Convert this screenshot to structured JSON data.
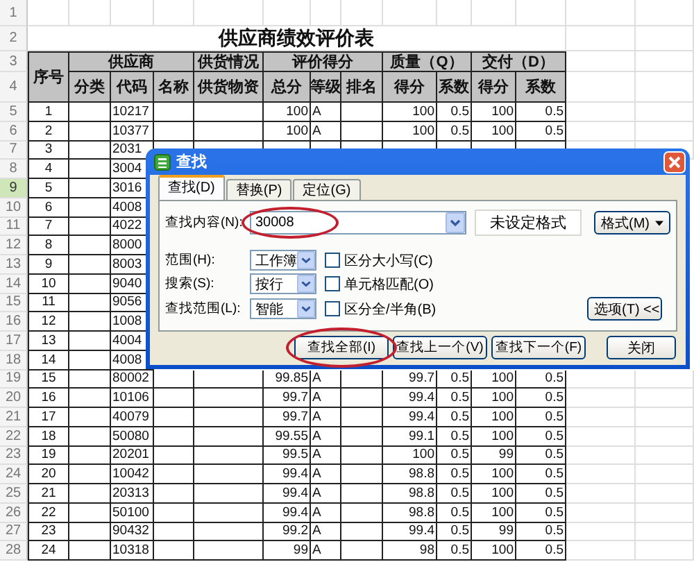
{
  "sheet": {
    "title": "供应商绩效评价表",
    "row_headers": [
      {
        "label": "1",
        "selected": false
      },
      {
        "label": "2",
        "selected": false
      },
      {
        "label": "3",
        "selected": false
      },
      {
        "label": "4",
        "selected": false
      },
      {
        "label": "5",
        "selected": false
      },
      {
        "label": "6",
        "selected": false
      },
      {
        "label": "7",
        "selected": false
      },
      {
        "label": "8",
        "selected": false
      },
      {
        "label": "9",
        "selected": true
      },
      {
        "label": "10",
        "selected": false
      },
      {
        "label": "11",
        "selected": false
      },
      {
        "label": "12",
        "selected": false
      },
      {
        "label": "13",
        "selected": false
      },
      {
        "label": "14",
        "selected": false
      },
      {
        "label": "15",
        "selected": false
      },
      {
        "label": "16",
        "selected": false
      },
      {
        "label": "17",
        "selected": false
      },
      {
        "label": "18",
        "selected": false
      },
      {
        "label": "19",
        "selected": false
      },
      {
        "label": "20",
        "selected": false
      },
      {
        "label": "21",
        "selected": false
      },
      {
        "label": "22",
        "selected": false
      },
      {
        "label": "23",
        "selected": false
      },
      {
        "label": "24",
        "selected": false
      },
      {
        "label": "25",
        "selected": false
      },
      {
        "label": "26",
        "selected": false
      },
      {
        "label": "27",
        "selected": false
      },
      {
        "label": "28",
        "selected": false
      }
    ],
    "group_headers": {
      "seq": "序号",
      "supplier": "供应商",
      "supply": "供货情况",
      "evaluation": "评价得分",
      "quality": "质量（Q）",
      "delivery": "交付（D）"
    },
    "sub_headers": [
      "分类",
      "代码",
      "名称",
      "供货物资",
      "总分",
      "等级",
      "排名",
      "得分",
      "系数",
      "得分",
      "系数"
    ],
    "rows": [
      {
        "seq": "1",
        "code": "10217",
        "total": "100",
        "grade": "A",
        "q_score": "100",
        "q_coef": "0.5",
        "d_score": "100",
        "d_coef": "0.5"
      },
      {
        "seq": "2",
        "code": "10377",
        "total": "100",
        "grade": "A",
        "q_score": "100",
        "q_coef": "0.5",
        "d_score": "100",
        "d_coef": "0.5"
      },
      {
        "seq": "3",
        "code": "2031"
      },
      {
        "seq": "4",
        "code": "3004"
      },
      {
        "seq": "5",
        "code": "3016"
      },
      {
        "seq": "6",
        "code": "4008"
      },
      {
        "seq": "7",
        "code": "4022"
      },
      {
        "seq": "8",
        "code": "8000"
      },
      {
        "seq": "9",
        "code": "8003"
      },
      {
        "seq": "10",
        "code": "9040"
      },
      {
        "seq": "11",
        "code": "9056"
      },
      {
        "seq": "12",
        "code": "1008"
      },
      {
        "seq": "13",
        "code": "4004"
      },
      {
        "seq": "14",
        "code": "4008"
      },
      {
        "seq": "15",
        "code": "80002",
        "total": "99.85",
        "grade": "A",
        "q_score": "99.7",
        "q_coef": "0.5",
        "d_score": "100",
        "d_coef": "0.5"
      },
      {
        "seq": "16",
        "code": "10106",
        "total": "99.7",
        "grade": "A",
        "q_score": "99.4",
        "q_coef": "0.5",
        "d_score": "100",
        "d_coef": "0.5"
      },
      {
        "seq": "17",
        "code": "40079",
        "total": "99.7",
        "grade": "A",
        "q_score": "99.4",
        "q_coef": "0.5",
        "d_score": "100",
        "d_coef": "0.5"
      },
      {
        "seq": "18",
        "code": "50080",
        "total": "99.55",
        "grade": "A",
        "q_score": "99.1",
        "q_coef": "0.5",
        "d_score": "100",
        "d_coef": "0.5"
      },
      {
        "seq": "19",
        "code": "20201",
        "total": "99.5",
        "grade": "A",
        "q_score": "100",
        "q_coef": "0.5",
        "d_score": "99",
        "d_coef": "0.5"
      },
      {
        "seq": "20",
        "code": "10042",
        "total": "99.4",
        "grade": "A",
        "q_score": "98.8",
        "q_coef": "0.5",
        "d_score": "100",
        "d_coef": "0.5"
      },
      {
        "seq": "21",
        "code": "20313",
        "total": "99.4",
        "grade": "A",
        "q_score": "98.8",
        "q_coef": "0.5",
        "d_score": "100",
        "d_coef": "0.5"
      },
      {
        "seq": "22",
        "code": "50100",
        "total": "99.4",
        "grade": "A",
        "q_score": "98.8",
        "q_coef": "0.5",
        "d_score": "100",
        "d_coef": "0.5"
      },
      {
        "seq": "23",
        "code": "90432",
        "total": "99.2",
        "grade": "A",
        "q_score": "99.4",
        "q_coef": "0.5",
        "d_score": "99",
        "d_coef": "0.5"
      },
      {
        "seq": "24",
        "code": "10318",
        "total": "99",
        "grade": "A",
        "q_score": "98",
        "q_coef": "0.5",
        "d_score": "100",
        "d_coef": "0.5"
      }
    ]
  },
  "find_dialog": {
    "title": "查找",
    "tabs": [
      {
        "label": "查找(D)",
        "selected": true
      },
      {
        "label": "替换(P)",
        "selected": false
      },
      {
        "label": "定位(G)",
        "selected": false
      }
    ],
    "find_label": "查找内容(N):",
    "find_field": {
      "value": "30008",
      "circled": true
    },
    "format_status": "未设定格式",
    "format_button": "格式(M)",
    "options": [
      {
        "label": "范围(H):",
        "value": "工作簿",
        "checkbox": {
          "label": "区分大小写(C)",
          "checked": false
        }
      },
      {
        "label": "搜索(S):",
        "value": "按行",
        "checkbox": {
          "label": "单元格匹配(O)",
          "checked": false
        }
      },
      {
        "label": "查找范围(L):",
        "value": "智能",
        "checkbox": {
          "label": "区分全/半角(B)",
          "checked": false
        }
      }
    ],
    "options_button": "选项(T) <<",
    "buttons": [
      {
        "label": "查找全部(I)",
        "circled": true
      },
      {
        "label": "查找上一个(V)",
        "circled": false
      },
      {
        "label": "查找下一个(F)",
        "circled": false
      }
    ],
    "close_button": "关闭"
  }
}
